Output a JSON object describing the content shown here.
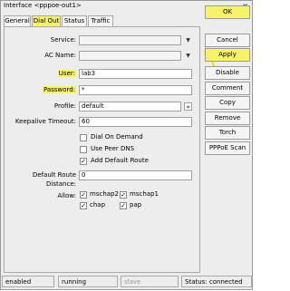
{
  "window": {
    "title": "Interface <pppoe-out1>",
    "close_glyph": "×"
  },
  "tabs": [
    {
      "label": "General"
    },
    {
      "label": "Dial Out"
    },
    {
      "label": "Status"
    },
    {
      "label": "Traffic"
    }
  ],
  "form": {
    "service": {
      "label": "Service:",
      "value": ""
    },
    "ac_name": {
      "label": "AC Name:",
      "value": ""
    },
    "user": {
      "label": "User:",
      "value": "lab3"
    },
    "password": {
      "label": "Password:",
      "value": "*"
    },
    "profile": {
      "label": "Profile:",
      "value": "default"
    },
    "keepalive": {
      "label": "Keepalive Timeout:",
      "value": "60"
    },
    "dial_on_demand": {
      "label": "Dial On Demand",
      "checked": false
    },
    "use_peer_dns": {
      "label": "Use Peer DNS",
      "checked": false
    },
    "add_default_route": {
      "label": "Add Default Route",
      "checked": true
    },
    "default_route_distance": {
      "label": "Default Route Distance:",
      "value": "0"
    },
    "allow": {
      "label": "Allow:",
      "options": [
        {
          "label": "mschap2",
          "checked": true
        },
        {
          "label": "mschap1",
          "checked": true
        },
        {
          "label": "chap",
          "checked": true
        },
        {
          "label": "pap",
          "checked": true
        }
      ]
    },
    "check_glyph": "✓",
    "dropdown_glyph": "▼",
    "profile_dropdown_glyph": "≑"
  },
  "buttons": {
    "ok": "OK",
    "cancel": "Cancel",
    "apply": "Apply",
    "disable": "Disable",
    "comment": "Comment",
    "copy": "Copy",
    "remove": "Remove",
    "torch": "Torch",
    "pppoe_scan": "PPPoE Scan"
  },
  "status": {
    "enabled": "enabled",
    "running": "running",
    "slave": "slave",
    "status": "Status: connected"
  },
  "colors": {
    "highlight": "#f6f36a",
    "arrow": "#f2e000"
  }
}
